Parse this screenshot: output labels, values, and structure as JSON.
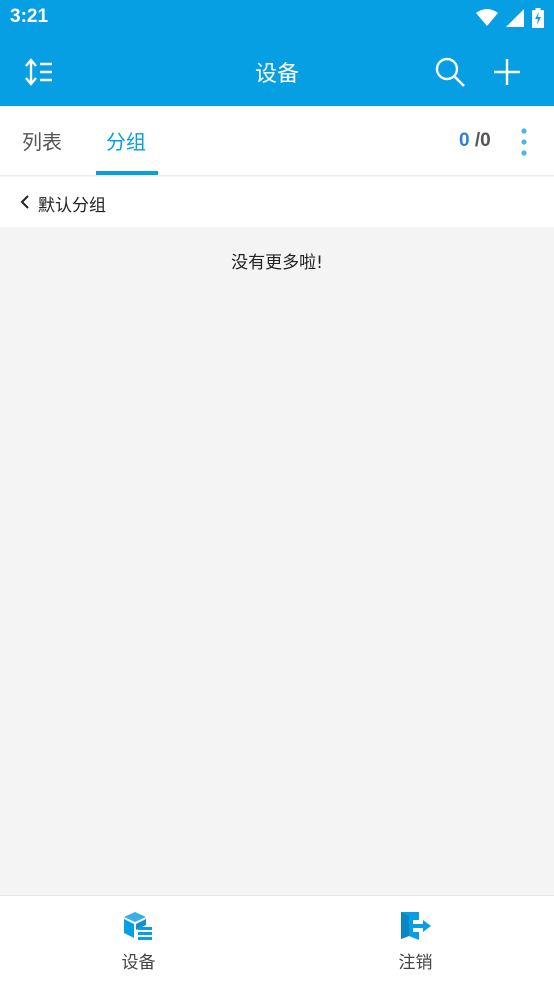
{
  "status_bar": {
    "time": "3:21"
  },
  "app_bar": {
    "title": "设备"
  },
  "tabs": {
    "list_label": "列表",
    "group_label": "分组",
    "active": "分组"
  },
  "counter": {
    "current": "0",
    "separator_total": "/0"
  },
  "group": {
    "name": "默认分组"
  },
  "content": {
    "empty_message": "没有更多啦!"
  },
  "bottom_nav": {
    "devices_label": "设备",
    "logout_label": "注销"
  },
  "colors": {
    "primary": "#069fe4",
    "counter_blue": "#2f7ed8",
    "background": "#f4f4f4"
  }
}
